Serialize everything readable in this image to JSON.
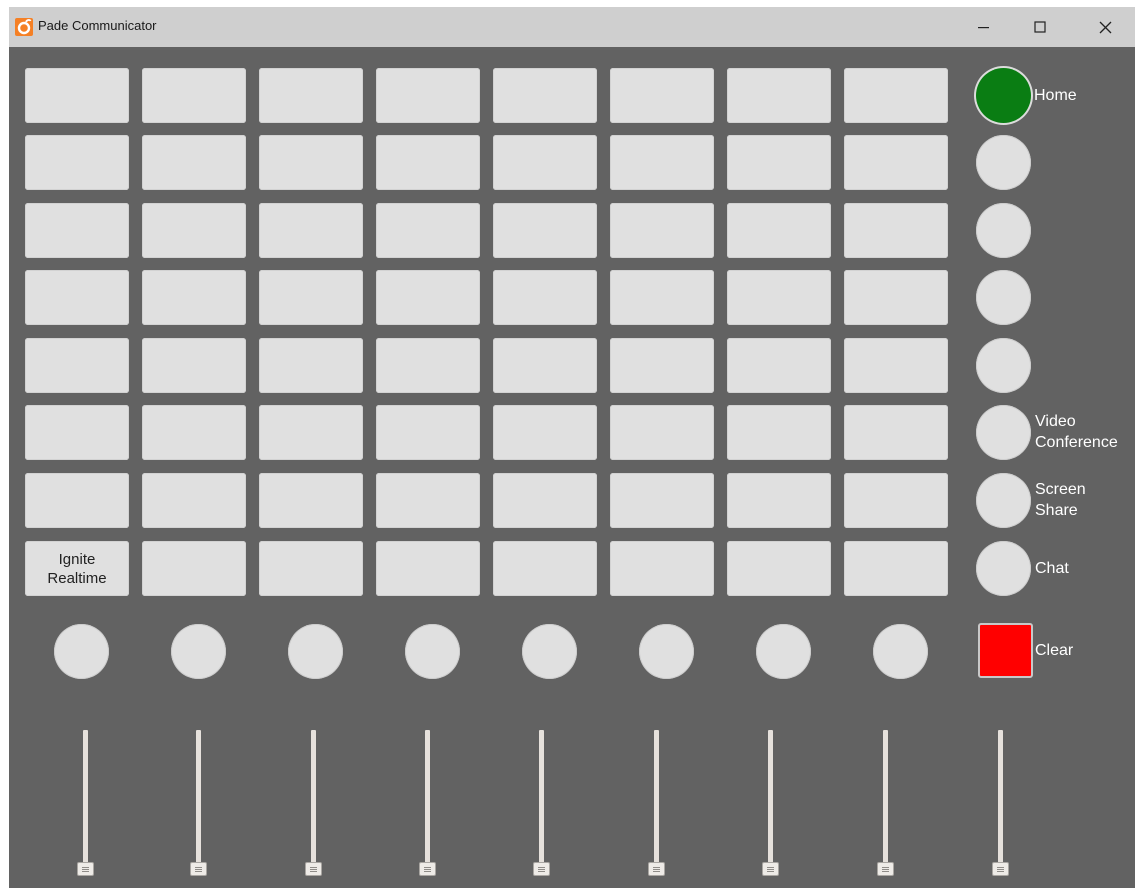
{
  "window": {
    "title": "Pade Communicator",
    "controls": {
      "minimize": "minimize-icon",
      "maximize": "maximize-icon",
      "close": "close-icon"
    }
  },
  "colors": {
    "background": "#626262",
    "pad": "#e0e0e0",
    "home_active": "#0a7d13",
    "clear": "#ff0000",
    "label": "#ffffff"
  },
  "grid": {
    "rows": 8,
    "cols": 8,
    "pads": [
      [
        "",
        "",
        "",
        "",
        "",
        "",
        "",
        ""
      ],
      [
        "",
        "",
        "",
        "",
        "",
        "",
        "",
        ""
      ],
      [
        "",
        "",
        "",
        "",
        "",
        "",
        "",
        ""
      ],
      [
        "",
        "",
        "",
        "",
        "",
        "",
        "",
        ""
      ],
      [
        "",
        "",
        "",
        "",
        "",
        "",
        "",
        ""
      ],
      [
        "",
        "",
        "",
        "",
        "",
        "",
        "",
        ""
      ],
      [
        "",
        "",
        "",
        "",
        "",
        "",
        "",
        ""
      ],
      [
        "Ignite\nRealtime",
        "",
        "",
        "",
        "",
        "",
        "",
        ""
      ]
    ]
  },
  "side_buttons": [
    {
      "label": "Home",
      "active": true
    },
    {
      "label": "",
      "active": false
    },
    {
      "label": "",
      "active": false
    },
    {
      "label": "",
      "active": false
    },
    {
      "label": "",
      "active": false
    },
    {
      "label": "Video\nConference",
      "active": false
    },
    {
      "label": "Screen\nShare",
      "active": false
    },
    {
      "label": "Chat",
      "active": false
    }
  ],
  "bottom_buttons": [
    "",
    "",
    "",
    "",
    "",
    "",
    "",
    ""
  ],
  "clear_button": {
    "label": "Clear"
  },
  "sliders": [
    0,
    0,
    0,
    0,
    0,
    0,
    0,
    0,
    0
  ]
}
